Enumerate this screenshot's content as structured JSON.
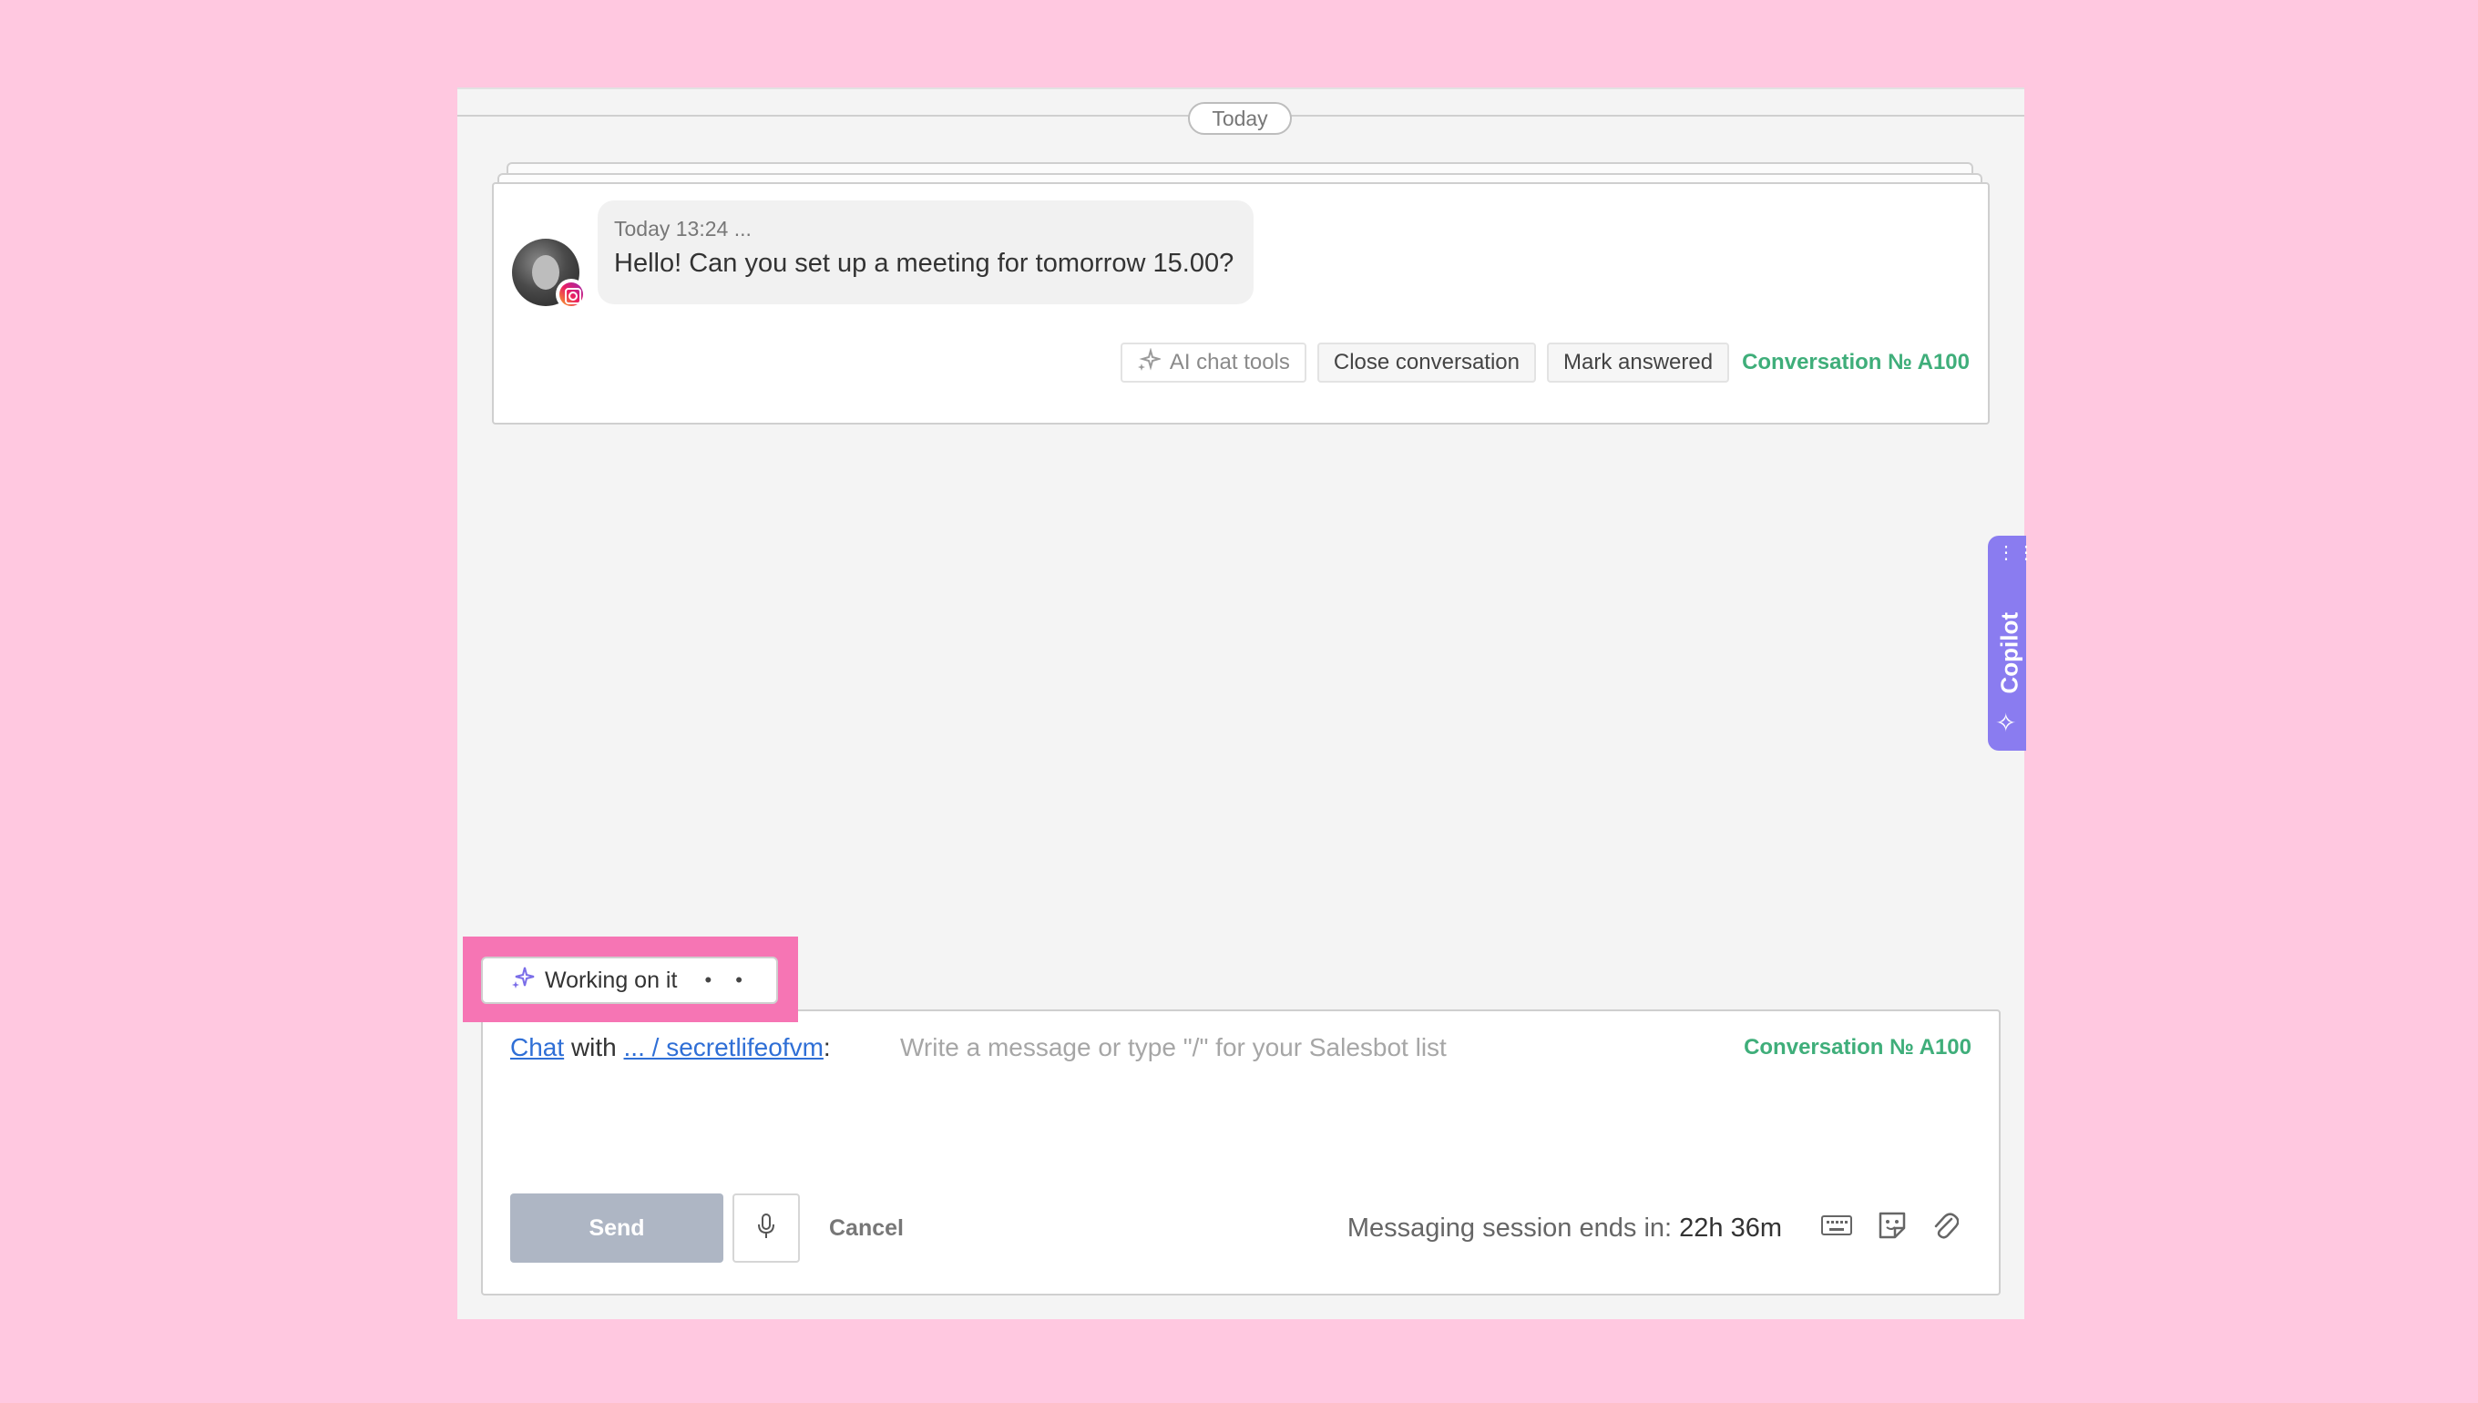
{
  "divider": {
    "date_label": "Today"
  },
  "message": {
    "time": "Today 13:24 ...",
    "text": "Hello! Can you set up a meeting for tomorrow 15.00?"
  },
  "card_actions": {
    "ai_tools_label": "AI chat tools",
    "close_label": "Close conversation",
    "mark_answered_label": "Mark answered",
    "conversation_label": "Conversation № A100"
  },
  "copilot": {
    "label": "Copilot"
  },
  "working": {
    "label": "Working on it",
    "dots": "• •"
  },
  "composer": {
    "chat_link": "Chat",
    "with_text": "with",
    "contact_link": "... / secretlifeofvm",
    "colon": ":",
    "placeholder": "Write a message or type \"/\" for your Salesbot list",
    "conversation_label": "Conversation № A100",
    "send_label": "Send",
    "cancel_label": "Cancel",
    "session_label": "Messaging session ends in:",
    "session_value": "22h 36m"
  },
  "colors": {
    "background": "#ffc8e0",
    "highlight": "#f675b4",
    "accent_green": "#3fae7a",
    "copilot": "#8a7cf0",
    "link": "#2f6fd6"
  },
  "icons": {
    "spark": "sparkles-icon",
    "mic": "microphone-icon",
    "keyboard": "keyboard-icon",
    "sticker": "sticker-icon",
    "attach": "paperclip-icon",
    "instagram": "instagram-icon"
  }
}
